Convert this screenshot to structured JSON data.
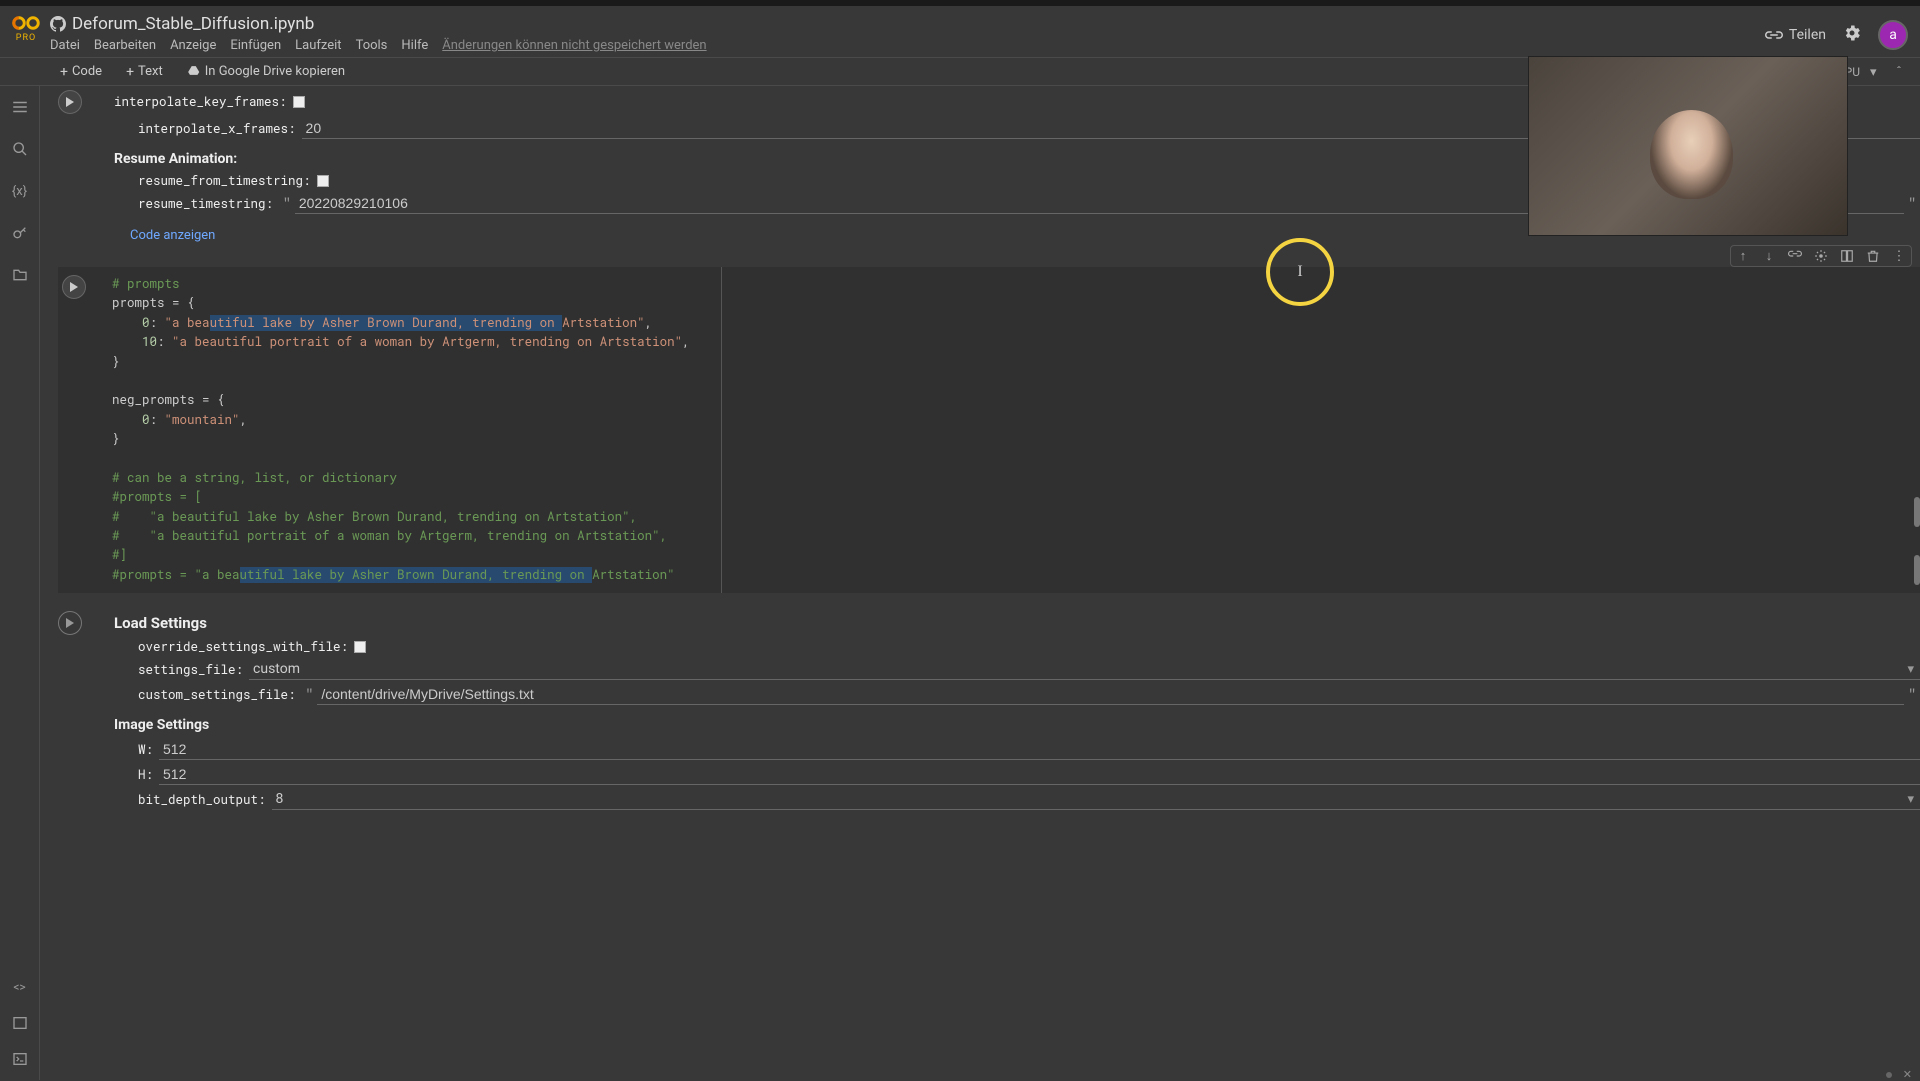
{
  "header": {
    "pro": "PRO",
    "title": "Deforum_Stable_Diffusion.ipynb",
    "menu": [
      "Datei",
      "Bearbeiten",
      "Anzeige",
      "Einfügen",
      "Laufzeit",
      "Tools",
      "Hilfe"
    ],
    "menu_warn": "Änderungen können nicht gespeichert werden",
    "share": "Teilen",
    "avatar": "a"
  },
  "toolbar": {
    "code": "Code",
    "text": "Text",
    "drive": "In Google Drive kopieren",
    "status": "GPU"
  },
  "form1": {
    "interpolate_key_frames_label": "interpolate_key_frames:",
    "interpolate_x_frames_label": "interpolate_x_frames:",
    "interpolate_x_frames_value": "20",
    "resume_section": "Resume Animation:",
    "resume_from_timestring_label": "resume_from_timestring:",
    "resume_timestring_label": "resume_timestring:",
    "resume_timestring_value": "20220829210106",
    "show_code": "Code anzeigen"
  },
  "code": {
    "l1": "# prompts",
    "l2a": "prompts ",
    "l2b": "=",
    "l2c": " {",
    "l3a": "    ",
    "l3b": "0",
    "l3c": ": ",
    "l3d": "\"a beautiful lake by Asher Brown Durand, trending on Artstation\"",
    "l3e": ",",
    "l4a": "    ",
    "l4b": "10",
    "l4c": ": ",
    "l4d": "\"a beautiful portrait of a woman by Artgerm, trending on Artstation\"",
    "l4e": ",",
    "l5": "}",
    "l6": "",
    "l7a": "neg_prompts ",
    "l7b": "=",
    "l7c": " {",
    "l8a": "    ",
    "l8b": "0",
    "l8c": ": ",
    "l8d": "\"mountain\"",
    "l8e": ",",
    "l9": "}",
    "l10": "",
    "l11": "# can be a string, list, or dictionary",
    "l12": "#prompts = [",
    "l13": "#    \"a beautiful lake by Asher Brown Durand, trending on Artstation\",",
    "l14": "#    \"a beautiful portrait of a woman by Artgerm, trending on Artstation\",",
    "l15": "#]",
    "l16": "#prompts = \"a beautiful lake by Asher Brown Durand, trending on Artstation\""
  },
  "form2": {
    "load_settings_head": "Load Settings",
    "override_label": "override_settings_with_file:",
    "settings_file_label": "settings_file:",
    "settings_file_value": "custom",
    "custom_settings_file_label": "custom_settings_file:",
    "custom_settings_file_value": "/content/drive/MyDrive/Settings.txt",
    "image_settings_head": "Image Settings",
    "w_label": "W:",
    "w_value": "512",
    "h_label": "H:",
    "h_value": "512",
    "bit_depth_label": "bit_depth_output:",
    "bit_depth_value": "8"
  }
}
